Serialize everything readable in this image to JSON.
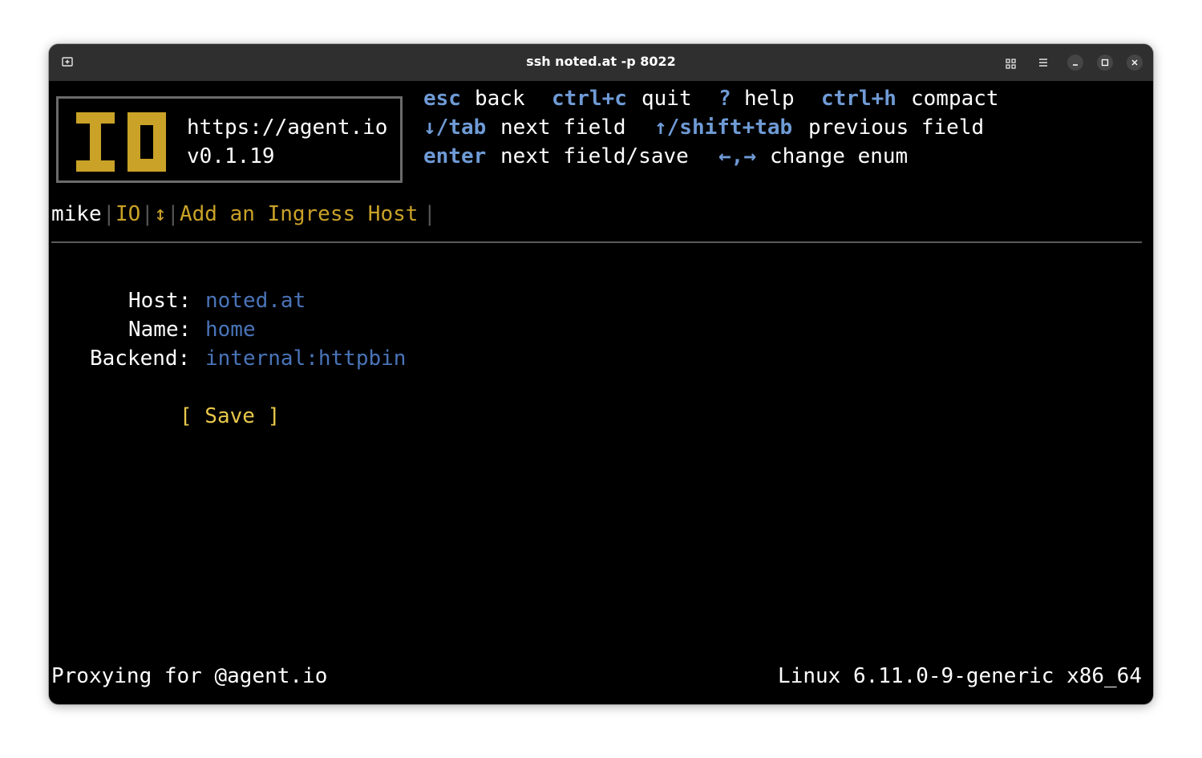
{
  "window": {
    "title": "ssh noted.at -p 8022"
  },
  "icons": {
    "new_tab": "new-tab-icon",
    "grid": "grid-view-icon",
    "menu": "hamburger-menu-icon",
    "minimize": "minimize-icon",
    "maximize": "maximize-icon",
    "close": "close-icon"
  },
  "colors": {
    "background": "#000000",
    "key": "#6f9bd6",
    "accent": "#c9a227",
    "value": "#4a74b8",
    "save": "#e8c84a"
  },
  "logo": {
    "url": "https://agent.io",
    "version": "v0.1.19"
  },
  "help": [
    [
      {
        "key": "esc",
        "desc": "back"
      },
      {
        "key": "ctrl+c",
        "desc": "quit"
      },
      {
        "key": "?",
        "desc": "help"
      },
      {
        "key": "ctrl+h",
        "desc": "compact"
      }
    ],
    [
      {
        "key": "↓/tab",
        "desc": "next field"
      },
      {
        "key": "↑/shift+tab",
        "desc": "previous field"
      }
    ],
    [
      {
        "key": "enter",
        "desc": "next field/save"
      },
      {
        "key": "←,→",
        "desc": "change enum"
      }
    ]
  ],
  "breadcrumb": {
    "user": "mike",
    "app": "IO",
    "nav_glyph": "↕",
    "page": "Add an Ingress Host",
    "sep": "|"
  },
  "form": {
    "host": {
      "label": "Host:",
      "value": "noted.at"
    },
    "name": {
      "label": "Name:",
      "value": "home"
    },
    "backend": {
      "label": "Backend:",
      "value": "internal:httpbin"
    },
    "save_label": "[ Save ]"
  },
  "footer": {
    "left": "Proxying for @agent.io",
    "right": "Linux 6.11.0-9-generic x86_64"
  }
}
